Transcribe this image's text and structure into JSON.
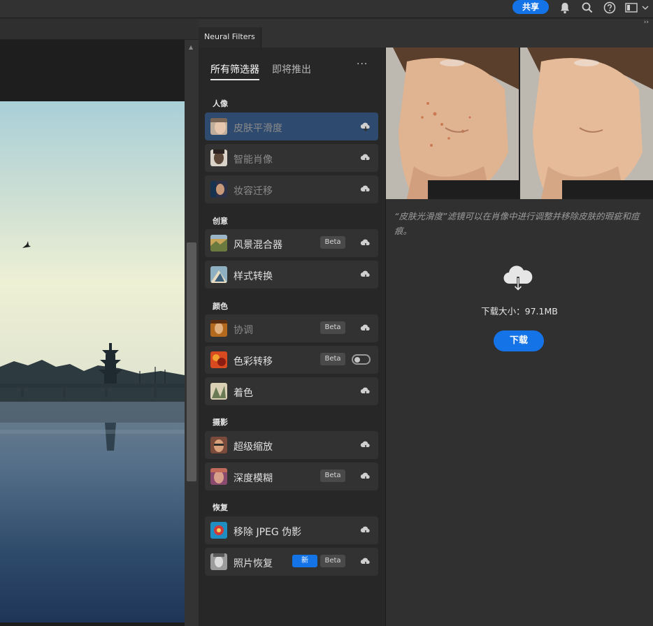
{
  "appbar": {
    "share_label": "共享",
    "icons": [
      "bell-icon",
      "search-icon",
      "help-icon",
      "workspace-icon",
      "chevron-down-icon"
    ]
  },
  "panel": {
    "tab_title": "Neural Filters",
    "collapse_glyph": "››"
  },
  "filters": {
    "tabs": [
      {
        "label": "所有筛选器",
        "active": true
      },
      {
        "label": "即将推出",
        "active": false
      }
    ],
    "more_label": "···",
    "categories": [
      {
        "name": "人像"
      },
      {
        "name": "创意"
      },
      {
        "name": "颜色"
      },
      {
        "name": "摄影"
      },
      {
        "name": "恢复"
      }
    ],
    "items": [
      {
        "label": "皮肤平滑度"
      },
      {
        "label": "智能肖像"
      },
      {
        "label": "妆容迁移"
      },
      {
        "label": "风景混合器",
        "badge": "Beta"
      },
      {
        "label": "样式转换"
      },
      {
        "label": "协调",
        "badge": "Beta"
      },
      {
        "label": "色彩转移",
        "badge": "Beta"
      },
      {
        "label": "着色"
      },
      {
        "label": "超级缩放"
      },
      {
        "label": "深度模糊",
        "badge": "Beta"
      },
      {
        "label": "移除 JPEG 伪影"
      },
      {
        "label": "照片恢复",
        "new_badge": "新",
        "badge": "Beta"
      }
    ]
  },
  "detail": {
    "description": "“皮肤光滑度”滤镜可以在肖像中进行调整并移除皮肤的瑕疵和痘痕。",
    "download_size": "下载大小：97.1MB",
    "download_label": "下载"
  },
  "colors": {
    "accent": "#1473e6",
    "panel_bg": "#272727",
    "selected_row": "#2e4a6e"
  }
}
